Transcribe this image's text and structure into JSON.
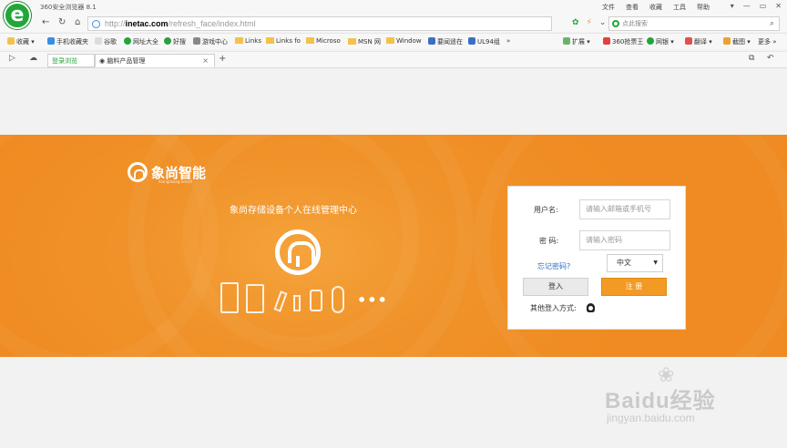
{
  "browser": {
    "title": "360安全浏览器 8.1",
    "menu": [
      "文件",
      "查看",
      "收藏",
      "工具",
      "帮助"
    ],
    "window_controls": [
      "▾",
      "—",
      "▭",
      "✕"
    ],
    "url": {
      "prefix": "http://",
      "host": "inetac.com",
      "path": "/refresh_face/index.html"
    },
    "search_placeholder": "点此搜索",
    "bookmarks_left": [
      "收藏",
      "手机收藏夹",
      "谷歌",
      "网址大全",
      "好搜",
      "游戏中心",
      "Links",
      "Links fo",
      "Microso",
      "MSN 网",
      "Window",
      "要闻遥在",
      "UL94组"
    ],
    "bookmarks_more": "»",
    "bookmarks_right": [
      "扩展",
      "360抢票王",
      "网银",
      "翻译",
      "截图",
      "更多"
    ],
    "tabs": [
      {
        "label": "登录浏览"
      },
      {
        "label": "脑料产品管理"
      }
    ],
    "tab_close": "×",
    "new_tab": "+"
  },
  "page": {
    "brand_name": "象尚智能",
    "brand_sub": "Xiangshang Smart",
    "slogan": "象尚存储设备个人在线管理中心",
    "more_dots": "•••",
    "accent_color": "#f0932a"
  },
  "login": {
    "username_label": "用户名:",
    "username_placeholder": "请输入邮箱或手机号",
    "password_label": "密 码:",
    "password_placeholder": "请输入密码",
    "forgot": "忘记密码?",
    "language": "中文",
    "login_button": "登入",
    "register_button": "注 册",
    "other_login": "其他登入方式:"
  },
  "watermark": {
    "main": "Baidu经验",
    "sub": "jingyan.baidu.com"
  }
}
